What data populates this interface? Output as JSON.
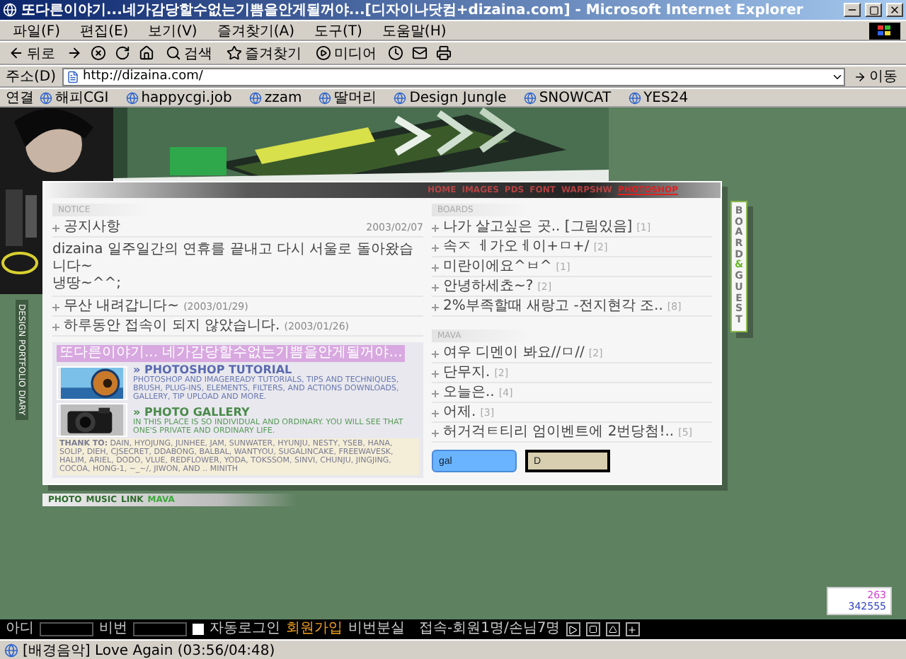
{
  "window": {
    "title": "또다른이야기...네가감당할수없는기쁨을안게될꺼야...[디자이나닷컴+dizaina.com] - Microsoft Internet Explorer"
  },
  "menu": [
    {
      "label": "파일(F)"
    },
    {
      "label": "편집(E)"
    },
    {
      "label": "보기(V)"
    },
    {
      "label": "즐겨찾기(A)"
    },
    {
      "label": "도구(T)"
    },
    {
      "label": "도움말(H)"
    }
  ],
  "toolbar": [
    {
      "kind": "back",
      "label": "뒤로"
    },
    {
      "kind": "forward"
    },
    {
      "kind": "stop"
    },
    {
      "kind": "refresh"
    },
    {
      "kind": "home"
    },
    {
      "kind": "search",
      "label": "검색"
    },
    {
      "kind": "favorites",
      "label": "즐겨찾기"
    },
    {
      "kind": "media",
      "label": "미디어"
    },
    {
      "kind": "history"
    },
    {
      "kind": "mail"
    },
    {
      "kind": "print"
    }
  ],
  "address": {
    "label": "주소(D)",
    "value": "http://dizaina.com/",
    "go": "이동"
  },
  "links": {
    "label": "연결",
    "items": [
      "해피CGI",
      "happycgi.job",
      "zzam",
      "딸머리",
      "Design Jungle",
      "SNOWCAT",
      "YES24"
    ]
  },
  "page": {
    "nav": [
      {
        "label": "HOME",
        "selected": false
      },
      {
        "label": "IMAGES",
        "selected": false
      },
      {
        "label": "PDS",
        "selected": false
      },
      {
        "label": "FONT",
        "selected": false
      },
      {
        "label": "WARPSHW",
        "selected": false
      },
      {
        "label": "PHOTOSHOP",
        "selected": true
      }
    ],
    "side_menu": "DESIGN PORTFOLIO DIARY",
    "notice": {
      "heading": "NOTICE",
      "title": "공지사항",
      "date": "2003/02/07",
      "body": "dizaina 일주일간의 연휴를 끝내고 다시 서울로 돌아왔습니다~\n냉땅~^^;",
      "items": [
        {
          "text": "무산 내려갑니다~",
          "date": "(2003/01/29)"
        },
        {
          "text": "하루동안 접속이 되지 않았습니다.",
          "date": "(2003/01/26)"
        }
      ]
    },
    "promo": {
      "headline": "또다른이야기... 네가감당할수없는기쁨을안게될꺼야...",
      "sections": [
        {
          "title": "» PHOTOSHOP TUTORIAL",
          "text": "PHOTOSHOP AND IMAGEREADY TUTORIALS, TIPS AND TECHNIQUES, BRUSH, PLUG-INS, ELEMENTS, FILTERS, AND ACTIONS DOWNLOADS, GALLERY, TIP UPLOAD AND MORE."
        },
        {
          "title": "» PHOTO GALLERY",
          "text": "IN THIS PLACE IS SO INDIVIDUAL AND ORDINARY. YOU WILL SEE THAT ONE'S PRIVATE AND ORDINARY LIFE."
        }
      ],
      "thanks_label": "THANK TO:",
      "thanks": "DAIN, HYOJUNG, JUNHEE, JAM, SUNWATER, HYUNJU, NESTY, YSEB, HANA, SOLIP, DIEH, CJSECRET, DDABONG, BALBAL, WANTYOU, SUGALINCAKE, FREEWAVESK, HALIM, ARIEL, DODO, VLUE, REDFLOWER, YODA, TOKSSOM, SINVI, CHUNJU, JINGJING, COCOA, HONG-1, ~_~/, JIWON, AND .. MINITH"
    },
    "boards": {
      "heading": "BOARDS",
      "items": [
        {
          "text": "나가 살고싶은 곳.. [그림있음]",
          "count": "[1]"
        },
        {
          "text": "속ㅈ ㅔ가오ㅔ이+ㅁ+/",
          "count": "[2]"
        },
        {
          "text": "미란이에요^ㅂ^",
          "count": "[1]"
        },
        {
          "text": "안녕하세쵸~?",
          "count": "[2]"
        },
        {
          "text": "2%부족할때 새랑고 -전지현각 조..",
          "count": "[8]"
        }
      ]
    },
    "mava": {
      "heading": "MAVA",
      "items": [
        {
          "text": "여우 디멘이 봐요//ㅁ//",
          "count": "[2]"
        },
        {
          "text": "단무지.",
          "count": "[2]"
        },
        {
          "text": "오늘은..",
          "count": "[4]"
        },
        {
          "text": "어제.",
          "count": "[3]"
        },
        {
          "text": "허거걱ㅌ티리 엄이벤트에 2번당첨!..",
          "count": "[5]"
        }
      ]
    },
    "buttons": [
      {
        "label": "gal",
        "kind": "blue"
      },
      {
        "label": "D",
        "kind": "dark"
      }
    ],
    "side_tab": [
      {
        "text": "BOARD",
        "highlight": false
      },
      {
        "text": "&",
        "highlight": true
      },
      {
        "text": "GUEST",
        "highlight": false
      }
    ],
    "footer_nav": [
      {
        "label": "PHOTO",
        "selected": false
      },
      {
        "label": "MUSIC",
        "selected": false
      },
      {
        "label": "LINK",
        "selected": false
      },
      {
        "label": "MAVA",
        "selected": true
      }
    ],
    "counter": {
      "today": "263",
      "total": "342555"
    },
    "login": {
      "id_label": "아디",
      "pw_label": "비번",
      "auto": {
        "label": "자동로그인",
        "checked": false
      },
      "join": "회원가입",
      "lost": "비번분실",
      "stats": "접속-회원1명/손님7명"
    }
  },
  "status_bar": "[배경음악] Love Again (03:56/04:48)"
}
